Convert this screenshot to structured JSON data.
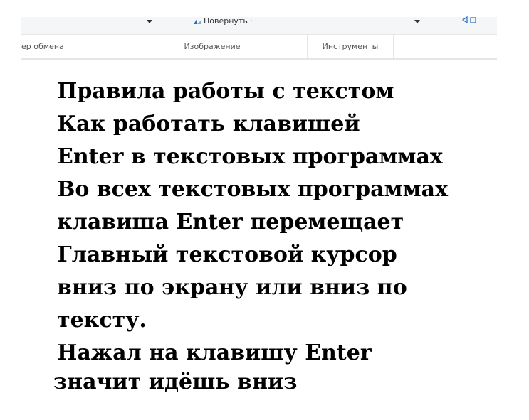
{
  "ribbon": {
    "rotate_label": "Повернуть",
    "rotate_caret": "·",
    "groups": {
      "clipboard": "ер обмена",
      "image": "Изображение",
      "tools": "Инструменты"
    }
  },
  "content": {
    "lines": [
      "Правила работы с текстом",
      "Как работать клавишей",
      "Enter в текстовых программах",
      "Во всех текстовых программах",
      "клавиша Enter перемещает",
      "Главный текстовой курсор",
      "вниз по экрану или вниз по",
      "тексту.",
      "Нажал на клавишу Enter",
      "значит идёшь вниз"
    ]
  }
}
